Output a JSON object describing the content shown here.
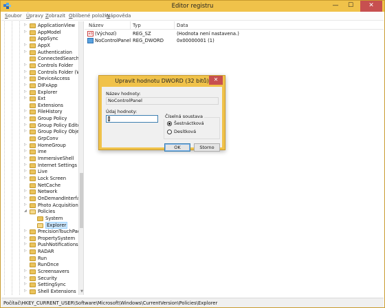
{
  "window": {
    "title": "Editor registru",
    "minimize": "—",
    "maximize": "☐",
    "close": "✕"
  },
  "menu": {
    "items": [
      {
        "u": "S",
        "rest": "oubor"
      },
      {
        "u": "Ú",
        "rest": "pravy"
      },
      {
        "u": "Z",
        "rest": "obrazit"
      },
      {
        "u": "O",
        "rest": "blíbené položky"
      },
      {
        "u": "N",
        "rest": "ápověda"
      }
    ]
  },
  "tree": {
    "items": [
      {
        "label": "ApplicationView",
        "exp": "▷"
      },
      {
        "label": "AppModel",
        "exp": "▷"
      },
      {
        "label": "AppSync",
        "exp": ""
      },
      {
        "label": "AppX",
        "exp": "▷"
      },
      {
        "label": "Authentication",
        "exp": "▷"
      },
      {
        "label": "ConnectedSearch",
        "exp": ""
      },
      {
        "label": "Controls Folder",
        "exp": "▷"
      },
      {
        "label": "Controls Folder (Wo",
        "exp": "▷"
      },
      {
        "label": "DeviceAccess",
        "exp": "▷"
      },
      {
        "label": "DIFxApp",
        "exp": "▷"
      },
      {
        "label": "Explorer",
        "exp": "▷"
      },
      {
        "label": "Ext",
        "exp": "▷"
      },
      {
        "label": "Extensions",
        "exp": ""
      },
      {
        "label": "FileHistory",
        "exp": "▷"
      },
      {
        "label": "Group Policy",
        "exp": "▷"
      },
      {
        "label": "Group Policy Editor",
        "exp": "▷"
      },
      {
        "label": "Group Policy Object",
        "exp": "▷"
      },
      {
        "label": "GrpConv",
        "exp": ""
      },
      {
        "label": "HomeGroup",
        "exp": "▷"
      },
      {
        "label": "ime",
        "exp": "▷"
      },
      {
        "label": "ImmersiveShell",
        "exp": "▷"
      },
      {
        "label": "Internet Settings",
        "exp": "▷"
      },
      {
        "label": "Live",
        "exp": "▷"
      },
      {
        "label": "Lock Screen",
        "exp": "▷"
      },
      {
        "label": "NetCache",
        "exp": ""
      },
      {
        "label": "Network",
        "exp": "▷"
      },
      {
        "label": "OnDemandInterface",
        "exp": "▷"
      },
      {
        "label": "Photo Acquisition",
        "exp": "▷"
      },
      {
        "label": "Policies",
        "exp": "◢",
        "open": true
      },
      {
        "label": "System",
        "exp": "",
        "indent": 1
      },
      {
        "label": "Explorer",
        "exp": "",
        "indent": 1,
        "selected": true
      },
      {
        "label": "PrecisionTouchPad",
        "exp": "▷"
      },
      {
        "label": "PropertySystem",
        "exp": "▷"
      },
      {
        "label": "PushNotifications",
        "exp": "▷"
      },
      {
        "label": "RADAR",
        "exp": "▷"
      },
      {
        "label": "Run",
        "exp": ""
      },
      {
        "label": "RunOnce",
        "exp": ""
      },
      {
        "label": "Screensavers",
        "exp": "▷"
      },
      {
        "label": "Security",
        "exp": "▷"
      },
      {
        "label": "SettingSync",
        "exp": "▷"
      },
      {
        "label": "Shell Extensions",
        "exp": "▷"
      }
    ]
  },
  "list": {
    "columns": [
      "Název",
      "Typ",
      "Data"
    ],
    "rows": [
      {
        "name": "(Výchozí)",
        "type": "REG_SZ",
        "data": "(Hodnota není nastavena.)",
        "icon": "string-value-icon"
      },
      {
        "name": "NoControlPanel",
        "type": "REG_DWORD",
        "data": "0x00000001 (1)",
        "icon": "dword-value-icon"
      }
    ]
  },
  "status": {
    "path": "Počítač\\HKEY_CURRENT_USER\\Software\\Microsoft\\Windows\\CurrentVersion\\Policies\\Explorer"
  },
  "dialog": {
    "title": "Upravit hodnotu DWORD (32 bitů)",
    "close": "✕",
    "name_label": "Název hodnoty:",
    "name_value": "NoControlPanel",
    "data_label": "Údaj hodnoty:",
    "data_value": "1",
    "base_label": "Číselná soustava",
    "radio_hex": "Šestnáctková",
    "radio_dec": "Desítková",
    "hex_checked": true,
    "ok": "OK",
    "cancel": "Storno"
  },
  "colors": {
    "title_accent": "#f0c24a",
    "close_red": "#c75050",
    "selection": "#cde8ff"
  }
}
